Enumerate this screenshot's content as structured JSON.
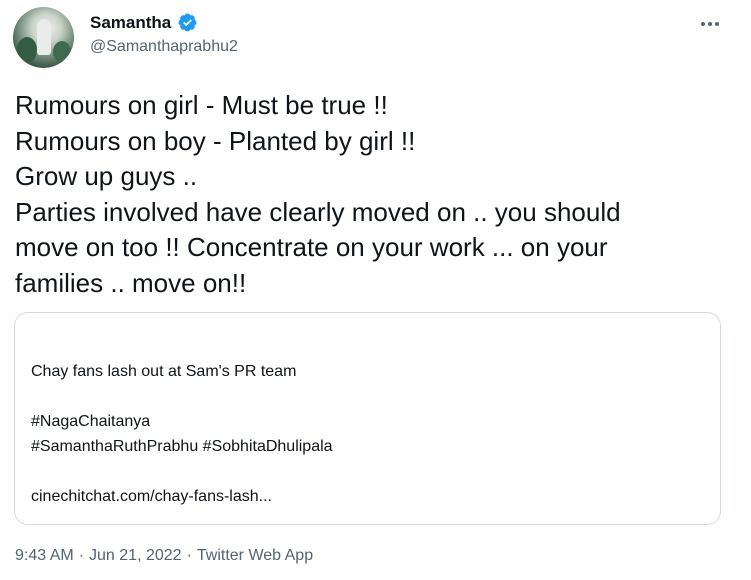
{
  "author": {
    "display_name": "Samantha",
    "handle": "@Samanthaprabhu2",
    "verified": true,
    "avatar_icon": "profile-photo"
  },
  "tweet": {
    "lines": [
      "Rumours on girl - Must be true !!",
      "Rumours on boy - Planted by girl !!",
      "Grow up guys ..",
      "Parties involved have clearly moved on .. you should",
      "move on too !! Concentrate on your work ... on your",
      "families .. move on!!"
    ]
  },
  "quoted_card": {
    "headline": "Chay fans lash out at Sam's PR team",
    "hashtag_line1": "#NagaChaitanya",
    "hashtag_line2": "#SamanthaRuthPrabhu #SobhitaDhulipala",
    "link": "cinechitchat.com/chay-fans-lash..."
  },
  "meta": {
    "time": "9:43 AM",
    "separator": "·",
    "date": "Jun 21, 2022",
    "source": "Twitter Web App"
  },
  "colors": {
    "text_primary": "#0f1419",
    "text_secondary": "#536471",
    "verified_blue": "#1d9bf0",
    "card_border": "#cfd9de"
  },
  "icons": {
    "more": "more-options-icon",
    "verified": "verified-badge-icon"
  }
}
